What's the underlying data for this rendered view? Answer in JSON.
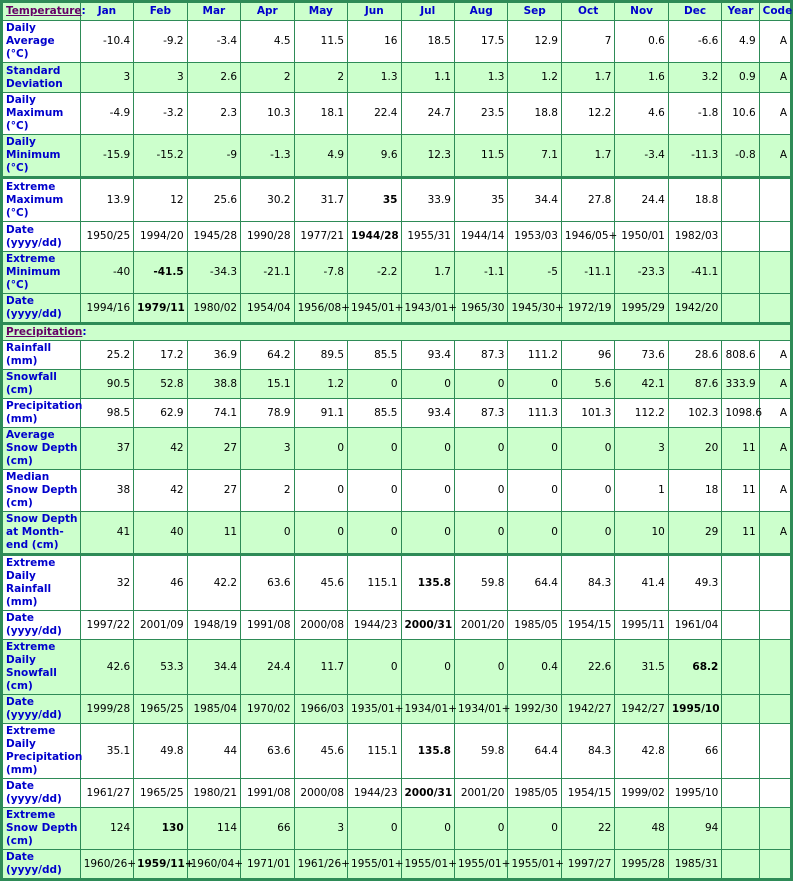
{
  "header": {
    "section_label": "Temperature",
    "columns": [
      "Jan",
      "Feb",
      "Mar",
      "Apr",
      "May",
      "Jun",
      "Jul",
      "Aug",
      "Sep",
      "Oct",
      "Nov",
      "Dec",
      "Year",
      "Code"
    ]
  },
  "temperature": {
    "rows": [
      {
        "label": "Daily Average (°C)",
        "values": [
          "-10.4",
          "-9.2",
          "-3.4",
          "4.5",
          "11.5",
          "16",
          "18.5",
          "17.5",
          "12.9",
          "7",
          "0.6",
          "-6.6",
          "4.9",
          "A"
        ],
        "bold": []
      },
      {
        "label": "Standard Deviation",
        "values": [
          "3",
          "3",
          "2.6",
          "2",
          "2",
          "1.3",
          "1.1",
          "1.3",
          "1.2",
          "1.7",
          "1.6",
          "3.2",
          "0.9",
          "A"
        ],
        "bold": []
      },
      {
        "label": "Daily Maximum (°C)",
        "values": [
          "-4.9",
          "-3.2",
          "2.3",
          "10.3",
          "18.1",
          "22.4",
          "24.7",
          "23.5",
          "18.8",
          "12.2",
          "4.6",
          "-1.8",
          "10.6",
          "A"
        ],
        "bold": []
      },
      {
        "label": "Daily Minimum (°C)",
        "values": [
          "-15.9",
          "-15.2",
          "-9",
          "-1.3",
          "4.9",
          "9.6",
          "12.3",
          "11.5",
          "7.1",
          "1.7",
          "-3.4",
          "-11.3",
          "-0.8",
          "A"
        ],
        "bold": []
      },
      {
        "label": "Extreme Maximum (°C)",
        "values": [
          "13.9",
          "12",
          "25.6",
          "30.2",
          "31.7",
          "35",
          "33.9",
          "35",
          "34.4",
          "27.8",
          "24.4",
          "18.8",
          "",
          ""
        ],
        "bold": [
          5
        ]
      },
      {
        "label": "Date (yyyy/dd)",
        "values": [
          "1950/25",
          "1994/20",
          "1945/28",
          "1990/28",
          "1977/21",
          "1944/28",
          "1955/31",
          "1944/14",
          "1953/03",
          "1946/05+",
          "1950/01",
          "1982/03",
          "",
          ""
        ],
        "bold": [
          5
        ]
      },
      {
        "label": "Extreme Minimum (°C)",
        "values": [
          "-40",
          "-41.5",
          "-34.3",
          "-21.1",
          "-7.8",
          "-2.2",
          "1.7",
          "-1.1",
          "-5",
          "-11.1",
          "-23.3",
          "-41.1",
          "",
          ""
        ],
        "bold": [
          1
        ]
      },
      {
        "label": "Date (yyyy/dd)",
        "values": [
          "1994/16",
          "1979/11",
          "1980/02",
          "1954/04",
          "1956/08+",
          "1945/01+",
          "1943/01+",
          "1965/30",
          "1945/30+",
          "1972/19",
          "1995/29",
          "1942/20",
          "",
          ""
        ],
        "bold": [
          1
        ]
      }
    ]
  },
  "precipitation": {
    "section_label": "Precipitation",
    "rows": [
      {
        "label": "Rainfall (mm)",
        "values": [
          "25.2",
          "17.2",
          "36.9",
          "64.2",
          "89.5",
          "85.5",
          "93.4",
          "87.3",
          "111.2",
          "96",
          "73.6",
          "28.6",
          "808.6",
          "A"
        ],
        "bold": []
      },
      {
        "label": "Snowfall (cm)",
        "values": [
          "90.5",
          "52.8",
          "38.8",
          "15.1",
          "1.2",
          "0",
          "0",
          "0",
          "0",
          "5.6",
          "42.1",
          "87.6",
          "333.9",
          "A"
        ],
        "bold": []
      },
      {
        "label": "Precipitation (mm)",
        "values": [
          "98.5",
          "62.9",
          "74.1",
          "78.9",
          "91.1",
          "85.5",
          "93.4",
          "87.3",
          "111.3",
          "101.3",
          "112.2",
          "102.3",
          "1098.6",
          "A"
        ],
        "bold": []
      },
      {
        "label": "Average Snow Depth (cm)",
        "values": [
          "37",
          "42",
          "27",
          "3",
          "0",
          "0",
          "0",
          "0",
          "0",
          "0",
          "3",
          "20",
          "11",
          "A"
        ],
        "bold": []
      },
      {
        "label": "Median Snow Depth (cm)",
        "values": [
          "38",
          "42",
          "27",
          "2",
          "0",
          "0",
          "0",
          "0",
          "0",
          "0",
          "1",
          "18",
          "11",
          "A"
        ],
        "bold": []
      },
      {
        "label": "Snow Depth at Month-end (cm)",
        "values": [
          "41",
          "40",
          "11",
          "0",
          "0",
          "0",
          "0",
          "0",
          "0",
          "0",
          "10",
          "29",
          "11",
          "A"
        ],
        "bold": []
      },
      {
        "label": "Extreme Daily Rainfall (mm)",
        "values": [
          "32",
          "46",
          "42.2",
          "63.6",
          "45.6",
          "115.1",
          "135.8",
          "59.8",
          "64.4",
          "84.3",
          "41.4",
          "49.3",
          "",
          ""
        ],
        "bold": [
          6
        ]
      },
      {
        "label": "Date (yyyy/dd)",
        "values": [
          "1997/22",
          "2001/09",
          "1948/19",
          "1991/08",
          "2000/08",
          "1944/23",
          "2000/31",
          "2001/20",
          "1985/05",
          "1954/15",
          "1995/11",
          "1961/04",
          "",
          ""
        ],
        "bold": [
          6
        ]
      },
      {
        "label": "Extreme Daily Snowfall (cm)",
        "values": [
          "42.6",
          "53.3",
          "34.4",
          "24.4",
          "11.7",
          "0",
          "0",
          "0",
          "0.4",
          "22.6",
          "31.5",
          "68.2",
          "",
          ""
        ],
        "bold": [
          11
        ]
      },
      {
        "label": "Date (yyyy/dd)",
        "values": [
          "1999/28",
          "1965/25",
          "1985/04",
          "1970/02",
          "1966/03",
          "1935/01+",
          "1934/01+",
          "1934/01+",
          "1992/30",
          "1942/27",
          "1942/27",
          "1995/10",
          "",
          ""
        ],
        "bold": [
          11
        ]
      },
      {
        "label": "Extreme Daily Precipitation (mm)",
        "values": [
          "35.1",
          "49.8",
          "44",
          "63.6",
          "45.6",
          "115.1",
          "135.8",
          "59.8",
          "64.4",
          "84.3",
          "42.8",
          "66",
          "",
          ""
        ],
        "bold": [
          6
        ]
      },
      {
        "label": "Date (yyyy/dd)",
        "values": [
          "1961/27",
          "1965/25",
          "1980/21",
          "1991/08",
          "2000/08",
          "1944/23",
          "2000/31",
          "2001/20",
          "1985/05",
          "1954/15",
          "1999/02",
          "1995/10",
          "",
          ""
        ],
        "bold": [
          6
        ]
      },
      {
        "label": "Extreme Snow Depth (cm)",
        "values": [
          "124",
          "130",
          "114",
          "66",
          "3",
          "0",
          "0",
          "0",
          "0",
          "22",
          "48",
          "94",
          "",
          ""
        ],
        "bold": [
          1
        ]
      },
      {
        "label": "Date (yyyy/dd)",
        "values": [
          "1960/26+",
          "1959/11+",
          "1960/04+",
          "1971/01",
          "1961/26+",
          "1955/01+",
          "1955/01+",
          "1955/01+",
          "1955/01+",
          "1997/27",
          "1995/28",
          "1985/31",
          "",
          ""
        ],
        "bold": [
          1
        ]
      }
    ]
  },
  "colors": {
    "border": "#2e8b57",
    "shaded_row": "#ccffcc",
    "label_text": "#0000cc",
    "section_link": "#660066"
  }
}
